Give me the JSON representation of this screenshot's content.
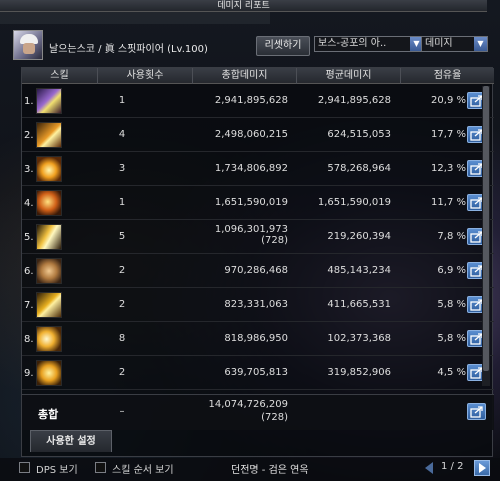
{
  "window": {
    "title": "데미지 리포트"
  },
  "header": {
    "character": "날으는스코 / 眞 스핏파이어 (Lv.100)",
    "reset_label": "리셋하기",
    "target_select": "보스-공포의 아..",
    "type_select": "데미지"
  },
  "columns": {
    "skill": "스킬",
    "uses": "사용횟수",
    "total": "총합데미지",
    "avg": "평균데미지",
    "share": "점유율"
  },
  "rows": [
    {
      "rank": "1.",
      "uses": "1",
      "total": "2,941,895,628",
      "total_sub": "",
      "avg": "2,941,895,628",
      "share": "20,9 %",
      "icon": "skill-1-icon"
    },
    {
      "rank": "2.",
      "uses": "4",
      "total": "2,498,060,215",
      "total_sub": "",
      "avg": "624,515,053",
      "share": "17,7 %",
      "icon": "skill-2-icon"
    },
    {
      "rank": "3.",
      "uses": "3",
      "total": "1,734,806,892",
      "total_sub": "",
      "avg": "578,268,964",
      "share": "12,3 %",
      "icon": "skill-3-icon"
    },
    {
      "rank": "4.",
      "uses": "1",
      "total": "1,651,590,019",
      "total_sub": "",
      "avg": "1,651,590,019",
      "share": "11,7 %",
      "icon": "skill-4-icon"
    },
    {
      "rank": "5.",
      "uses": "5",
      "total": "1,096,301,973",
      "total_sub": "(728)",
      "avg": "219,260,394",
      "share": "7,8 %",
      "icon": "skill-5-icon"
    },
    {
      "rank": "6.",
      "uses": "2",
      "total": "970,286,468",
      "total_sub": "",
      "avg": "485,143,234",
      "share": "6,9 %",
      "icon": "skill-6-icon"
    },
    {
      "rank": "7.",
      "uses": "2",
      "total": "823,331,063",
      "total_sub": "",
      "avg": "411,665,531",
      "share": "5,8 %",
      "icon": "skill-7-icon"
    },
    {
      "rank": "8.",
      "uses": "8",
      "total": "818,986,950",
      "total_sub": "",
      "avg": "102,373,368",
      "share": "5,8 %",
      "icon": "skill-8-icon"
    },
    {
      "rank": "9.",
      "uses": "2",
      "total": "639,705,813",
      "total_sub": "",
      "avg": "319,852,906",
      "share": "4,5 %",
      "icon": "skill-9-icon"
    }
  ],
  "total": {
    "label": "총합",
    "uses": "–",
    "damage": "14,074,726,209",
    "damage_sub": "(728)"
  },
  "settings_tab": "사용한 설정",
  "footer": {
    "dps_label": "DPS 보기",
    "skill_order_label": "스킬 순서 보기",
    "info": "던전명 - 검은 연옥",
    "page": "1 / 2"
  }
}
